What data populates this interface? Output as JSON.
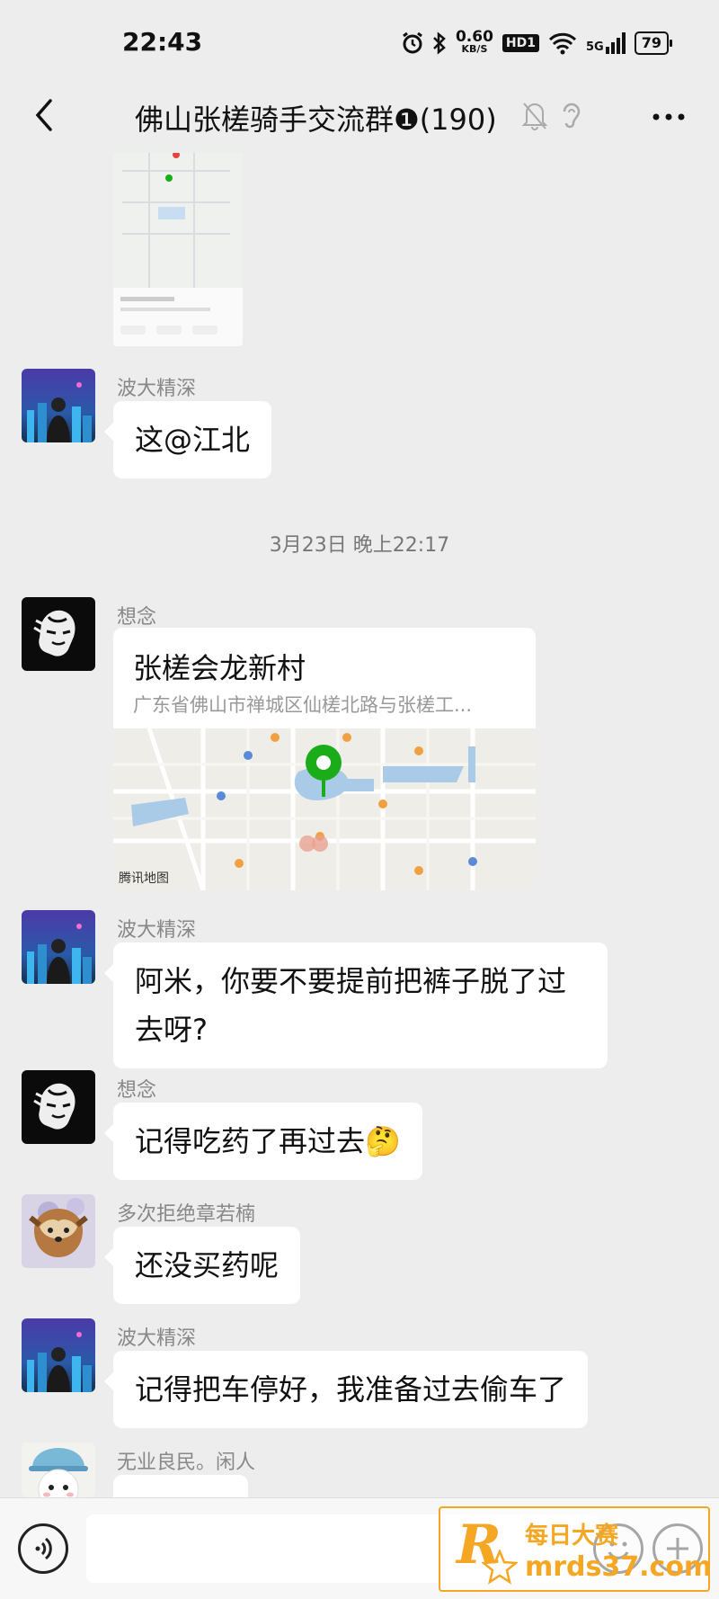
{
  "status_bar": {
    "time": "22:43",
    "net_speed_value": "0.60",
    "net_speed_unit": "KB/S",
    "hd_label": "HD1",
    "network_label": "5G",
    "battery": "79",
    "icons": [
      "alarm-icon",
      "bluetooth-icon",
      "wifi-icon",
      "signal-icon"
    ]
  },
  "header": {
    "title": "佛山张槎骑手交流群❶(190)",
    "icons": [
      "back-icon",
      "mute-icon",
      "ear-icon",
      "more-icon"
    ]
  },
  "messages": [
    {
      "sender": "波大精深",
      "text": "这@江北"
    },
    {
      "timestamp": "3月23日 晚上22:17"
    },
    {
      "sender": "想念",
      "location_title": "张槎会龙新村",
      "location_address": "广东省佛山市禅城区仙槎北路与张槎工...",
      "map_provider": "腾讯地图"
    },
    {
      "sender": "波大精深",
      "text_line1": "阿米，你要不要提前把裤子脱了过",
      "text_line2": "去呀?"
    },
    {
      "sender": "想念",
      "text": "记得吃药了再过去🤔"
    },
    {
      "sender": "多次拒绝章若楠",
      "text": "还没买药呢"
    },
    {
      "sender": "波大精深",
      "text": "记得把车停好，我准备过去偷车了"
    },
    {
      "sender": "无业良民。闲人"
    }
  ],
  "input_bar": {
    "placeholder": "",
    "icons": [
      "voice-icon",
      "emoji-icon",
      "plus-icon"
    ]
  },
  "watermark": {
    "letter": "R",
    "line1": "每日大赛",
    "line2": "mrds37.com"
  },
  "colors": {
    "background": "#ededed",
    "bubble": "#ffffff",
    "map_pin": "#1aad19",
    "watermark": "#f5a623"
  }
}
